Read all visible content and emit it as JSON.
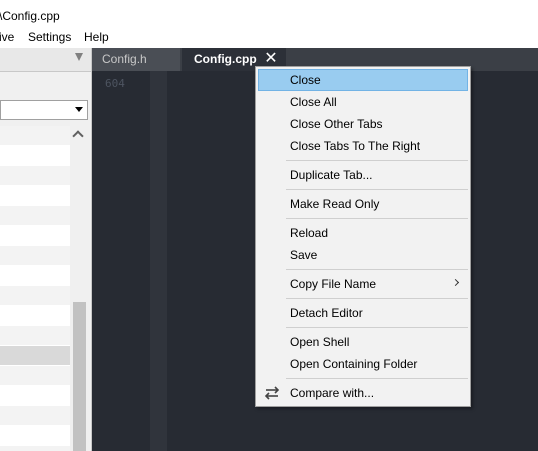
{
  "window": {
    "title": "\\Config.cpp"
  },
  "menubar": {
    "items": [
      "ive",
      "Settings",
      "Help"
    ]
  },
  "editor": {
    "tabs": [
      {
        "label": "Config.h",
        "active": false
      },
      {
        "label": "Config.cpp",
        "active": true,
        "close_glyph": "✕"
      }
    ],
    "line_number": "604"
  },
  "context_menu": {
    "items": [
      {
        "label": "Close",
        "highlighted": true
      },
      {
        "label": "Close All"
      },
      {
        "label": "Close Other Tabs"
      },
      {
        "label": "Close Tabs To The Right"
      },
      {
        "label": "Duplicate Tab..."
      },
      {
        "label": "Make Read Only"
      },
      {
        "label": "Reload"
      },
      {
        "label": "Save"
      },
      {
        "label": "Copy File Name",
        "submenu": true
      },
      {
        "label": "Detach Editor"
      },
      {
        "label": "Open Shell"
      },
      {
        "label": "Open Containing Folder"
      },
      {
        "label": "Compare with...",
        "icon": "swap-arrows-icon"
      }
    ]
  },
  "colors": {
    "editor_bg": "#272b33",
    "tabbar_bg": "#3b3f46",
    "highlight": "#99ccf0",
    "menu_bg": "#f2f2f2"
  }
}
